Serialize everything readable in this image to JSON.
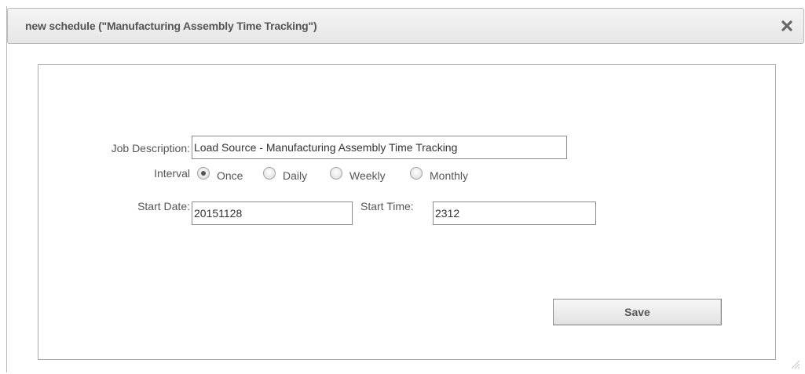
{
  "dialog": {
    "title": "new schedule (\"Manufacturing Assembly Time Tracking\")",
    "close_icon": "close-x-icon"
  },
  "form": {
    "job_description_label": "Job Description:",
    "job_description_value": "Load Source - Manufacturing Assembly Time Tracking",
    "interval_label": "Interval",
    "interval_options": [
      "Once",
      "Daily",
      "Weekly",
      "Monthly"
    ],
    "interval_selected": "Once",
    "start_date_label": "Start Date:",
    "start_date_value": "20151128",
    "start_time_label": "Start Time:",
    "start_time_value": "2312",
    "save_label": "Save"
  }
}
